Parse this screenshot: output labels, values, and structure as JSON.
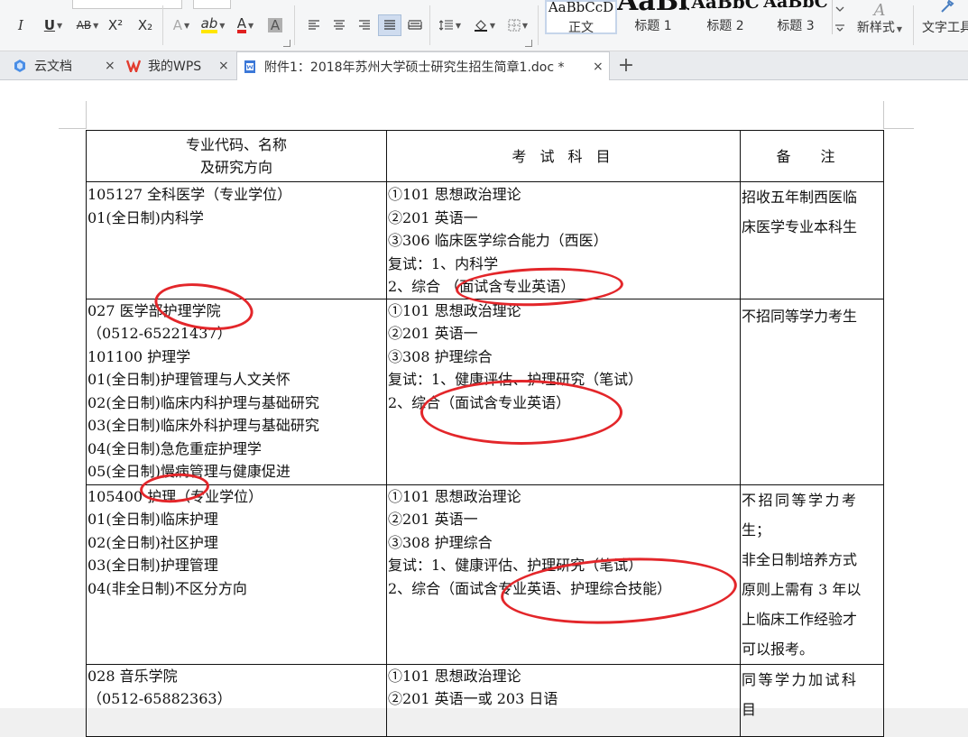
{
  "toolbar": {
    "italic": "I",
    "underline": "U",
    "strike": "AB",
    "superscript": "X²",
    "subscript": "X₂",
    "text_effect": "A",
    "highlight": "ab",
    "font_color": "A",
    "char_shading": "A"
  },
  "styles": [
    {
      "sample": "AaBbCcD",
      "label": "正文"
    },
    {
      "sample": "AaBb",
      "label": "标题 1"
    },
    {
      "sample": "AaBbC",
      "label": "标题 2"
    },
    {
      "sample": "AaBbC",
      "label": "标题 3"
    }
  ],
  "new_style": {
    "icon_text": "A",
    "label": "新样式"
  },
  "text_tools": {
    "label": "文字工具"
  },
  "tabs": [
    {
      "label": "云文档"
    },
    {
      "label": "我的WPS"
    },
    {
      "label": "附件1：2018年苏州大学硕士研究生招生简章1.doc *"
    }
  ],
  "new_tab": "+",
  "close_glyph": "×",
  "table": {
    "headers": [
      "专业代码、名称",
      "及研究方向",
      "考 试 科 目",
      "备 注"
    ],
    "rows": [
      {
        "major": [
          "105127 全科医学（专业学位）",
          "01(全日制)内科学"
        ],
        "exam": [
          "①101 思想政治理论",
          "②201 英语一",
          "③306 临床医学综合能力（西医）",
          "复试：1、内科学",
          "2、综合 （面试含专业英语）"
        ],
        "note": [
          "招收五年制西医临",
          "床医学专业本科生"
        ]
      },
      {
        "major": [
          "027 医学部护理学院",
          "（0512-65221437）",
          "101100 护理学",
          "01(全日制)护理管理与人文关怀",
          "02(全日制)临床内科护理与基础研究",
          "03(全日制)临床外科护理与基础研究",
          "04(全日制)急危重症护理学",
          "05(全日制)慢病管理与健康促进"
        ],
        "exam": [
          "①101 思想政治理论",
          "②201 英语一",
          "③308 护理综合",
          "复试：1、健康评估、护理研究（笔试）",
          "2、综合（面试含专业英语）"
        ],
        "note": [
          "不招同等学力考生"
        ]
      },
      {
        "major": [
          "105400 护理（专业学位）",
          "01(全日制)临床护理",
          "02(全日制)社区护理",
          "03(全日制)护理管理",
          "04(非全日制)不区分方向"
        ],
        "exam": [
          "①101 思想政治理论",
          "②201 英语一",
          "③308 护理综合",
          "复试：1、健康评估、护理研究（笔试）",
          "2、综合（面试含专业英语、护理综合技能）"
        ],
        "note": [
          "不招同等学力考",
          "生；",
          "非全日制培养方式",
          "原则上需有 3 年以",
          "上临床工作经验才",
          "可以报考。"
        ]
      },
      {
        "major": [
          "028 音乐学院",
          "（0512-65882363）"
        ],
        "exam": [
          "①101 思想政治理论",
          "②201 英语一或 203 日语"
        ],
        "note": [
          "同等学力加试科",
          "目"
        ]
      }
    ]
  }
}
